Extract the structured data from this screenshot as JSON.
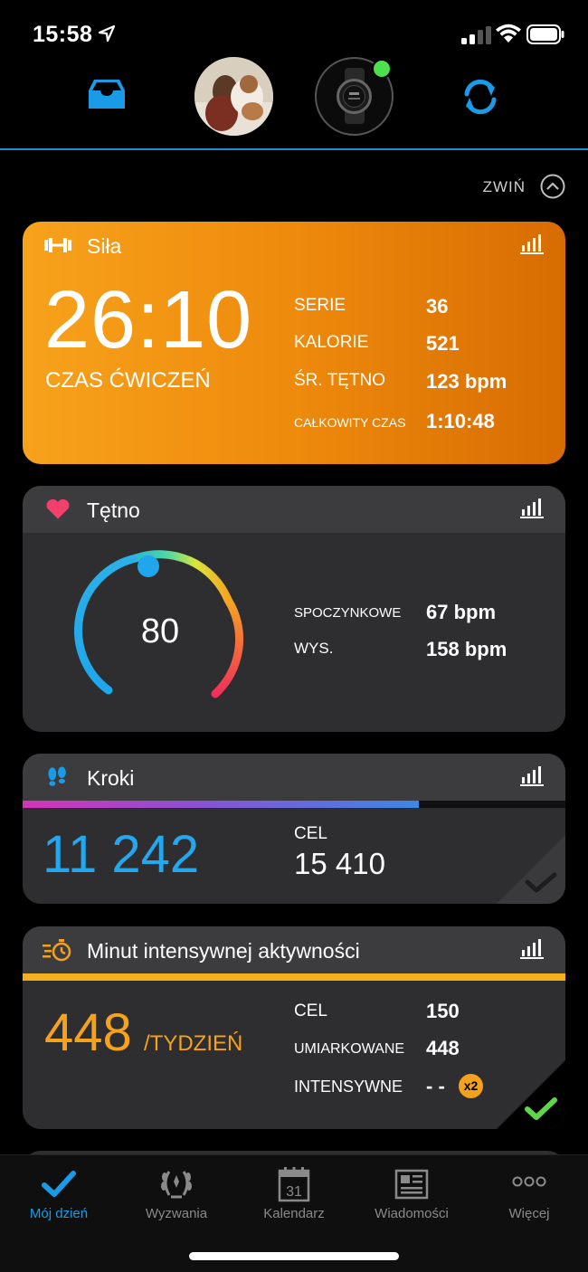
{
  "status": {
    "time": "15:58"
  },
  "header": {
    "inbox_icon": "inbox-icon",
    "avatar": "profile-avatar",
    "device": "watch-device",
    "device_status_color": "#4ce04c",
    "sync_icon": "sync-icon",
    "accent_color": "#1a9be8"
  },
  "collapse": {
    "label": "ZWIŃ"
  },
  "strength": {
    "title": "Siła",
    "time": "26:10",
    "subtitle": "CZAS ĆWICZEŃ",
    "stats": [
      {
        "label": "SERIE",
        "value": "36"
      },
      {
        "label": "KALORIE",
        "value": "521"
      },
      {
        "label": "ŚR. TĘTNO",
        "value": "123 bpm"
      },
      {
        "label": "CAŁKOWITY CZAS",
        "value": "1:10:48"
      }
    ],
    "color": "#f29614"
  },
  "heart": {
    "title": "Tętno",
    "current": "80",
    "stats": [
      {
        "label": "SPOCZYNKOWE",
        "value": "67 bpm"
      },
      {
        "label": "WYS.",
        "value": "158 bpm"
      }
    ]
  },
  "steps": {
    "title": "Kroki",
    "value": "11 242",
    "goal_label": "CEL",
    "goal_value": "15 410",
    "progress": 0.73,
    "value_color": "#23a7ee"
  },
  "intensity": {
    "title": "Minut intensywnej aktywności",
    "value": "448",
    "unit": "/TYDZIEŃ",
    "stats": [
      {
        "label": "CEL",
        "value": "150"
      },
      {
        "label": "UMIARKOWANE",
        "value": "448"
      },
      {
        "label": "INTENSYWNE",
        "value": "- -"
      }
    ],
    "badge": "x2",
    "value_color": "#f7a21c",
    "check_color": "#5ed649"
  },
  "tabs": [
    {
      "label": "Mój dzień",
      "icon": "checkmark-icon",
      "active": true
    },
    {
      "label": "Wyzwania",
      "icon": "laurel-icon",
      "active": false
    },
    {
      "label": "Kalendarz",
      "icon": "calendar-icon",
      "date": "31",
      "active": false
    },
    {
      "label": "Wiadomości",
      "icon": "newspaper-icon",
      "active": false
    },
    {
      "label": "Więcej",
      "icon": "more-icon",
      "active": false
    }
  ]
}
